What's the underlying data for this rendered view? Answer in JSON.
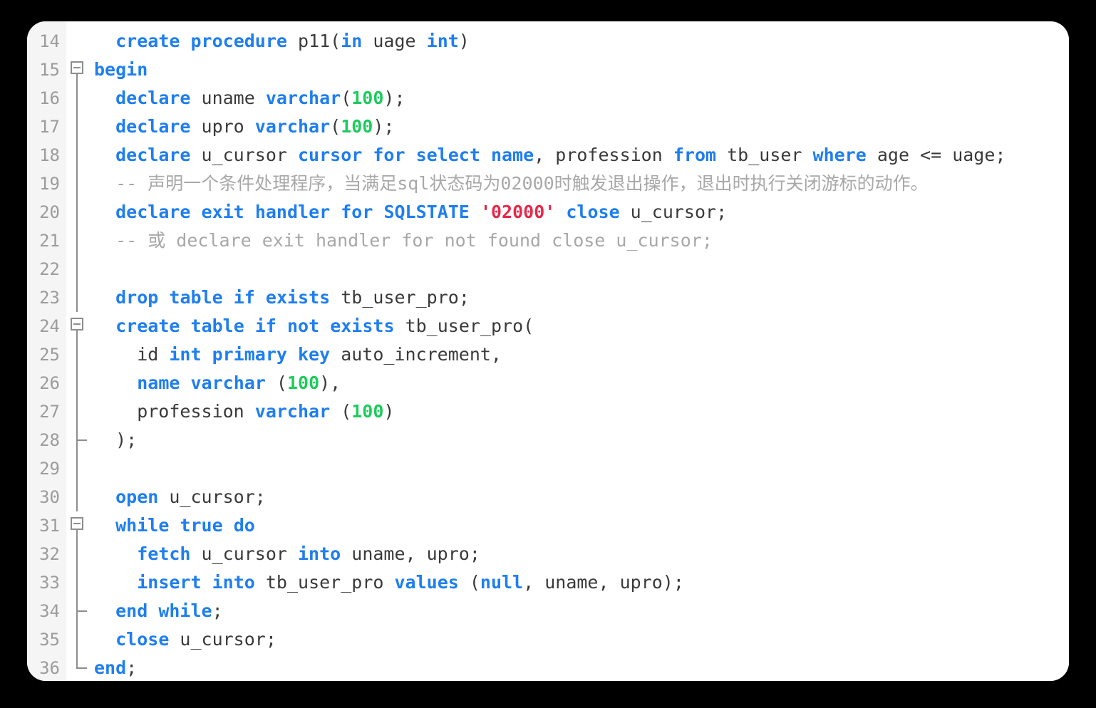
{
  "editor": {
    "language": "sql",
    "first_line_number": 14,
    "colors": {
      "background": "#ffffff",
      "page_background": "#000000",
      "gutter_background": "#f5f5f5",
      "line_number": "#9c9c9c",
      "plain_text": "#3a3a3a",
      "keyword": "#1f7ef0",
      "number": "#1ecb5e",
      "string": "#e5294a",
      "comment": "#a8a8a8",
      "fold_guide": "#8d8d8d"
    },
    "lines": [
      {
        "number": "14",
        "fold": "none",
        "tokens": [
          {
            "t": "  ",
            "c": "pln"
          },
          {
            "t": "create",
            "c": "kw"
          },
          {
            "t": " ",
            "c": "pln"
          },
          {
            "t": "procedure",
            "c": "kw"
          },
          {
            "t": " p11(",
            "c": "pln"
          },
          {
            "t": "in",
            "c": "kw"
          },
          {
            "t": " uage ",
            "c": "pln"
          },
          {
            "t": "int",
            "c": "kw"
          },
          {
            "t": ")",
            "c": "pln"
          }
        ]
      },
      {
        "number": "15",
        "fold": "box",
        "tokens": [
          {
            "t": "begin",
            "c": "kw"
          }
        ]
      },
      {
        "number": "16",
        "fold": "line",
        "tokens": [
          {
            "t": "  ",
            "c": "pln"
          },
          {
            "t": "declare",
            "c": "kw"
          },
          {
            "t": " uname ",
            "c": "pln"
          },
          {
            "t": "varchar",
            "c": "kw"
          },
          {
            "t": "(",
            "c": "pln"
          },
          {
            "t": "100",
            "c": "num"
          },
          {
            "t": ");",
            "c": "pln"
          }
        ]
      },
      {
        "number": "17",
        "fold": "line",
        "tokens": [
          {
            "t": "  ",
            "c": "pln"
          },
          {
            "t": "declare",
            "c": "kw"
          },
          {
            "t": " upro ",
            "c": "pln"
          },
          {
            "t": "varchar",
            "c": "kw"
          },
          {
            "t": "(",
            "c": "pln"
          },
          {
            "t": "100",
            "c": "num"
          },
          {
            "t": ");",
            "c": "pln"
          }
        ]
      },
      {
        "number": "18",
        "fold": "line",
        "tokens": [
          {
            "t": "  ",
            "c": "pln"
          },
          {
            "t": "declare",
            "c": "kw"
          },
          {
            "t": " u_cursor ",
            "c": "pln"
          },
          {
            "t": "cursor",
            "c": "kw"
          },
          {
            "t": " ",
            "c": "pln"
          },
          {
            "t": "for",
            "c": "kw"
          },
          {
            "t": " ",
            "c": "pln"
          },
          {
            "t": "select",
            "c": "kw"
          },
          {
            "t": " ",
            "c": "pln"
          },
          {
            "t": "name",
            "c": "kw"
          },
          {
            "t": ", profession ",
            "c": "pln"
          },
          {
            "t": "from",
            "c": "kw"
          },
          {
            "t": " tb_user ",
            "c": "pln"
          },
          {
            "t": "where",
            "c": "kw"
          },
          {
            "t": " age <= uage;",
            "c": "pln"
          }
        ]
      },
      {
        "number": "19",
        "fold": "line",
        "tokens": [
          {
            "t": "  -- 声明一个条件处理程序，当满足sql状态码为02000时触发退出操作，退出时执行关闭游标的动作。",
            "c": "cmt"
          }
        ]
      },
      {
        "number": "20",
        "fold": "line",
        "tokens": [
          {
            "t": "  ",
            "c": "pln"
          },
          {
            "t": "declare",
            "c": "kw"
          },
          {
            "t": " ",
            "c": "pln"
          },
          {
            "t": "exit",
            "c": "kw"
          },
          {
            "t": " ",
            "c": "pln"
          },
          {
            "t": "handler",
            "c": "kw"
          },
          {
            "t": " ",
            "c": "pln"
          },
          {
            "t": "for",
            "c": "kw"
          },
          {
            "t": " ",
            "c": "pln"
          },
          {
            "t": "SQLSTATE",
            "c": "kw"
          },
          {
            "t": " ",
            "c": "pln"
          },
          {
            "t": "'02000'",
            "c": "str"
          },
          {
            "t": " ",
            "c": "pln"
          },
          {
            "t": "close",
            "c": "kw"
          },
          {
            "t": " u_cursor;",
            "c": "pln"
          }
        ]
      },
      {
        "number": "21",
        "fold": "line",
        "tokens": [
          {
            "t": "  -- 或 declare exit handler for not found close u_cursor;",
            "c": "cmt"
          }
        ]
      },
      {
        "number": "22",
        "fold": "line",
        "tokens": [
          {
            "t": "",
            "c": "pln"
          }
        ]
      },
      {
        "number": "23",
        "fold": "line",
        "tokens": [
          {
            "t": "  ",
            "c": "pln"
          },
          {
            "t": "drop",
            "c": "kw"
          },
          {
            "t": " ",
            "c": "pln"
          },
          {
            "t": "table",
            "c": "kw"
          },
          {
            "t": " ",
            "c": "pln"
          },
          {
            "t": "if",
            "c": "kw"
          },
          {
            "t": " ",
            "c": "pln"
          },
          {
            "t": "exists",
            "c": "kw"
          },
          {
            "t": " tb_user_pro;",
            "c": "pln"
          }
        ]
      },
      {
        "number": "24",
        "fold": "box",
        "tokens": [
          {
            "t": "  ",
            "c": "pln"
          },
          {
            "t": "create",
            "c": "kw"
          },
          {
            "t": " ",
            "c": "pln"
          },
          {
            "t": "table",
            "c": "kw"
          },
          {
            "t": " ",
            "c": "pln"
          },
          {
            "t": "if",
            "c": "kw"
          },
          {
            "t": " ",
            "c": "pln"
          },
          {
            "t": "not",
            "c": "kw"
          },
          {
            "t": " ",
            "c": "pln"
          },
          {
            "t": "exists",
            "c": "kw"
          },
          {
            "t": " tb_user_pro(",
            "c": "pln"
          }
        ]
      },
      {
        "number": "25",
        "fold": "line",
        "tokens": [
          {
            "t": "    id ",
            "c": "pln"
          },
          {
            "t": "int",
            "c": "kw"
          },
          {
            "t": " ",
            "c": "pln"
          },
          {
            "t": "primary",
            "c": "kw"
          },
          {
            "t": " ",
            "c": "pln"
          },
          {
            "t": "key",
            "c": "kw"
          },
          {
            "t": " auto_increment,",
            "c": "pln"
          }
        ]
      },
      {
        "number": "26",
        "fold": "line",
        "tokens": [
          {
            "t": "    ",
            "c": "pln"
          },
          {
            "t": "name",
            "c": "kw"
          },
          {
            "t": " ",
            "c": "pln"
          },
          {
            "t": "varchar",
            "c": "kw"
          },
          {
            "t": " (",
            "c": "pln"
          },
          {
            "t": "100",
            "c": "num"
          },
          {
            "t": "),",
            "c": "pln"
          }
        ]
      },
      {
        "number": "27",
        "fold": "line",
        "tokens": [
          {
            "t": "    profession ",
            "c": "pln"
          },
          {
            "t": "varchar",
            "c": "kw"
          },
          {
            "t": " (",
            "c": "pln"
          },
          {
            "t": "100",
            "c": "num"
          },
          {
            "t": ")",
            "c": "pln"
          }
        ]
      },
      {
        "number": "28",
        "fold": "tick",
        "tokens": [
          {
            "t": "  );",
            "c": "pln"
          }
        ]
      },
      {
        "number": "29",
        "fold": "line",
        "tokens": [
          {
            "t": "",
            "c": "pln"
          }
        ]
      },
      {
        "number": "30",
        "fold": "line",
        "tokens": [
          {
            "t": "  ",
            "c": "pln"
          },
          {
            "t": "open",
            "c": "kw"
          },
          {
            "t": " u_cursor;",
            "c": "pln"
          }
        ]
      },
      {
        "number": "31",
        "fold": "box",
        "tokens": [
          {
            "t": "  ",
            "c": "pln"
          },
          {
            "t": "while",
            "c": "kw"
          },
          {
            "t": " ",
            "c": "pln"
          },
          {
            "t": "true",
            "c": "kw"
          },
          {
            "t": " ",
            "c": "pln"
          },
          {
            "t": "do",
            "c": "kw"
          }
        ]
      },
      {
        "number": "32",
        "fold": "line",
        "tokens": [
          {
            "t": "    ",
            "c": "pln"
          },
          {
            "t": "fetch",
            "c": "kw"
          },
          {
            "t": " u_cursor ",
            "c": "pln"
          },
          {
            "t": "into",
            "c": "kw"
          },
          {
            "t": " uname, upro;",
            "c": "pln"
          }
        ]
      },
      {
        "number": "33",
        "fold": "line",
        "tokens": [
          {
            "t": "    ",
            "c": "pln"
          },
          {
            "t": "insert",
            "c": "kw"
          },
          {
            "t": " ",
            "c": "pln"
          },
          {
            "t": "into",
            "c": "kw"
          },
          {
            "t": " tb_user_pro ",
            "c": "pln"
          },
          {
            "t": "values",
            "c": "kw"
          },
          {
            "t": " (",
            "c": "pln"
          },
          {
            "t": "null",
            "c": "kw"
          },
          {
            "t": ", uname, upro);",
            "c": "pln"
          }
        ]
      },
      {
        "number": "34",
        "fold": "tick",
        "tokens": [
          {
            "t": "  ",
            "c": "pln"
          },
          {
            "t": "end",
            "c": "kw"
          },
          {
            "t": " ",
            "c": "pln"
          },
          {
            "t": "while",
            "c": "kw"
          },
          {
            "t": ";",
            "c": "pln"
          }
        ]
      },
      {
        "number": "35",
        "fold": "line",
        "tokens": [
          {
            "t": "  ",
            "c": "pln"
          },
          {
            "t": "close",
            "c": "kw"
          },
          {
            "t": " u_cursor;",
            "c": "pln"
          }
        ]
      },
      {
        "number": "36",
        "fold": "corner",
        "tokens": [
          {
            "t": "end",
            "c": "kw"
          },
          {
            "t": ";",
            "c": "pln"
          }
        ]
      }
    ]
  }
}
